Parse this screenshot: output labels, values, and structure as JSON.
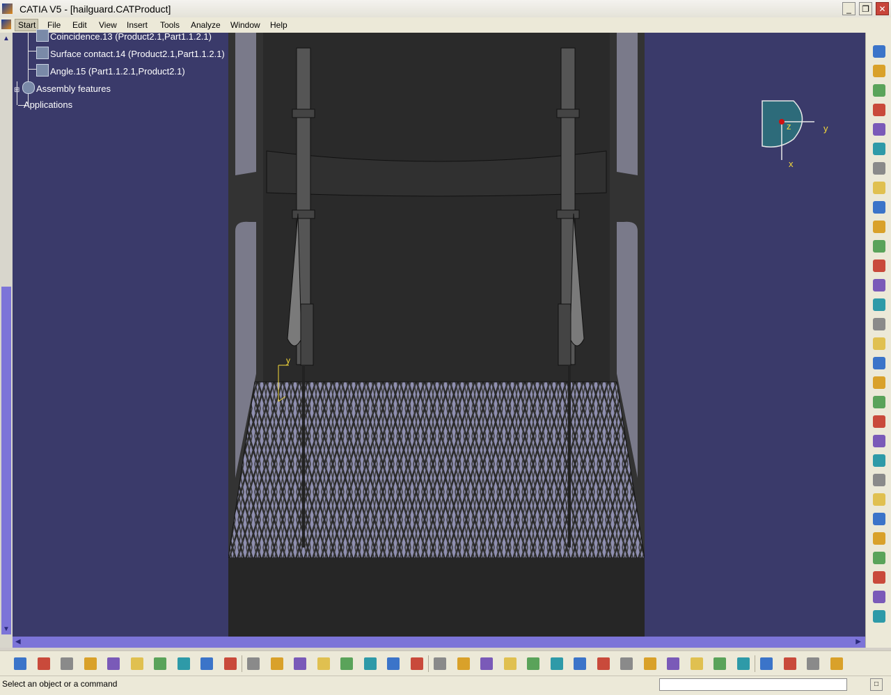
{
  "window": {
    "title": "CATIA V5 - [hailguard.CATProduct]",
    "minimize_glyph": "_",
    "restore_glyph": "❐",
    "close_glyph": "✕"
  },
  "menu": {
    "items": [
      "Start",
      "File",
      "Edit",
      "View",
      "Insert",
      "Tools",
      "Analyze",
      "Window",
      "Help"
    ]
  },
  "tree": {
    "nodes": [
      {
        "label": "Coincidence.13 (Product2.1,Part1.1.2.1)",
        "icon": "constraint-icon"
      },
      {
        "label": "Surface contact.14 (Product2.1,Part1.1.2.1)",
        "icon": "surface-contact-icon"
      },
      {
        "label": "Angle.15 (Part1.1.2.1,Product2.1)",
        "icon": "angle-constraint-icon"
      },
      {
        "label": "Assembly features",
        "icon": "assembly-features-icon"
      },
      {
        "label": "Applications",
        "icon": ""
      }
    ]
  },
  "compass": {
    "z_label": "z",
    "y_label": "y",
    "x_label": "x"
  },
  "axis_triad": {
    "y_label": "y"
  },
  "right_toolbar": {
    "icons": [
      "sketcher-icon",
      "select-arrow-icon",
      "catalog-icon",
      "existing-component-icon",
      "existing-component-positioning-icon",
      "new-part-icon",
      "replace-component-icon",
      "graph-tree-reordering-icon",
      "generate-numbering-icon",
      "selective-load-icon",
      "manage-representations-icon",
      "multi-instantiation-icon",
      "fast-multi-instantiation-icon",
      "reuse-pattern-icon",
      "explode-icon",
      "manipulation-icon",
      "snap-icon",
      "smart-move-icon",
      "clash-icon",
      "coincidence-constraint-icon",
      "contact-constraint-icon",
      "offset-constraint-icon",
      "angle-constraint-icon",
      "fix-component-icon",
      "fix-together-icon",
      "quick-constraint-icon",
      "flexible-rigid-icon",
      "change-constraint-icon",
      "reuse-constraint-icon",
      "update-icon"
    ]
  },
  "bottom_toolbar": {
    "icons": [
      "new-icon",
      "open-icon",
      "save-icon",
      "print-icon",
      "cut-icon",
      "copy-icon",
      "paste-icon",
      "undo-icon",
      "redo-icon",
      "whats-this-icon",
      "formula-icon",
      "knowledge-advisor-icon",
      "design-table-icon",
      "table-icon",
      "law-icon",
      "measure-icon",
      "catalog-browser-icon",
      "fly-mode-icon",
      "fit-all-icon",
      "pan-icon",
      "rotate-icon",
      "zoom-in-icon",
      "zoom-out-icon",
      "normal-view-icon",
      "quick-view-icon",
      "create-multi-view-icon",
      "view-mode-icon",
      "hide-show-icon",
      "swap-visible-space-icon",
      "apply-material-icon",
      "render-icon",
      "3d-compass-icon",
      "update-all-icon",
      "product-structure-icon",
      "analysis-icon",
      "catia-logo-icon"
    ]
  },
  "status": {
    "message": "Select an object or a command",
    "command_input": ""
  }
}
